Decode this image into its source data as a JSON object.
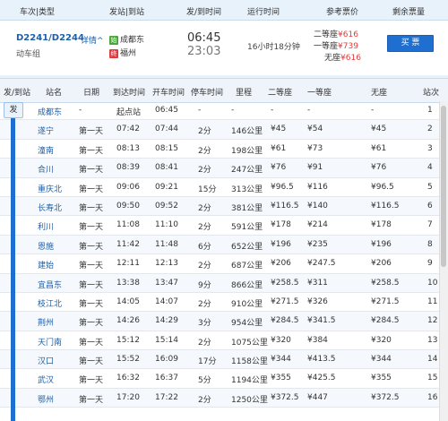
{
  "header": {
    "train_type": "车次|类型",
    "from_to": "发站|到站",
    "depart_arrive": "发/到时间",
    "duration": "运行时间",
    "ref_price": "参考票价",
    "remain": "剩余票量"
  },
  "train": {
    "number": "D2241/D2244",
    "detail_label": "详情",
    "type": "动车组",
    "from_tag": "始",
    "from_station": "成都东",
    "to_tag": "终",
    "to_station": "福州",
    "depart_time": "06:45",
    "arrive_time": "23:03",
    "duration": "16小时18分钟",
    "prices": [
      {
        "label": "二等座",
        "value": "¥616"
      },
      {
        "label": "一等座",
        "value": "¥739"
      },
      {
        "label": "无座",
        "value": "¥616"
      }
    ],
    "buy_label": "买 票"
  },
  "stations_header": {
    "col_fa": "发/到站",
    "col_name": "站名",
    "col_day": "日期",
    "col_arr": "到达时间",
    "col_dep": "开车时间",
    "col_stop": "停车时间",
    "col_dist": "里程",
    "col_second": "二等座",
    "col_first": "一等座",
    "col_none": "无座",
    "col_idx": "站次"
  },
  "fa_badge": "发",
  "stations": [
    {
      "name": "成都东",
      "day": "-",
      "arr": "起点站",
      "dep": "06:45",
      "stop": "-",
      "dist": "-",
      "second": "-",
      "first": "-",
      "none": "-",
      "idx": "1"
    },
    {
      "name": "遂宁",
      "day": "第一天",
      "arr": "07:42",
      "dep": "07:44",
      "stop": "2分",
      "dist": "146公里",
      "second": "¥45",
      "first": "¥54",
      "none": "¥45",
      "idx": "2"
    },
    {
      "name": "潼南",
      "day": "第一天",
      "arr": "08:13",
      "dep": "08:15",
      "stop": "2分",
      "dist": "198公里",
      "second": "¥61",
      "first": "¥73",
      "none": "¥61",
      "idx": "3"
    },
    {
      "name": "合川",
      "day": "第一天",
      "arr": "08:39",
      "dep": "08:41",
      "stop": "2分",
      "dist": "247公里",
      "second": "¥76",
      "first": "¥91",
      "none": "¥76",
      "idx": "4"
    },
    {
      "name": "重庆北",
      "day": "第一天",
      "arr": "09:06",
      "dep": "09:21",
      "stop": "15分",
      "dist": "313公里",
      "second": "¥96.5",
      "first": "¥116",
      "none": "¥96.5",
      "idx": "5"
    },
    {
      "name": "长寿北",
      "day": "第一天",
      "arr": "09:50",
      "dep": "09:52",
      "stop": "2分",
      "dist": "381公里",
      "second": "¥116.5",
      "first": "¥140",
      "none": "¥116.5",
      "idx": "6"
    },
    {
      "name": "利川",
      "day": "第一天",
      "arr": "11:08",
      "dep": "11:10",
      "stop": "2分",
      "dist": "591公里",
      "second": "¥178",
      "first": "¥214",
      "none": "¥178",
      "idx": "7"
    },
    {
      "name": "恩施",
      "day": "第一天",
      "arr": "11:42",
      "dep": "11:48",
      "stop": "6分",
      "dist": "652公里",
      "second": "¥196",
      "first": "¥235",
      "none": "¥196",
      "idx": "8"
    },
    {
      "name": "建始",
      "day": "第一天",
      "arr": "12:11",
      "dep": "12:13",
      "stop": "2分",
      "dist": "687公里",
      "second": "¥206",
      "first": "¥247.5",
      "none": "¥206",
      "idx": "9"
    },
    {
      "name": "宜昌东",
      "day": "第一天",
      "arr": "13:38",
      "dep": "13:47",
      "stop": "9分",
      "dist": "866公里",
      "second": "¥258.5",
      "first": "¥311",
      "none": "¥258.5",
      "idx": "10"
    },
    {
      "name": "枝江北",
      "day": "第一天",
      "arr": "14:05",
      "dep": "14:07",
      "stop": "2分",
      "dist": "910公里",
      "second": "¥271.5",
      "first": "¥326",
      "none": "¥271.5",
      "idx": "11"
    },
    {
      "name": "荆州",
      "day": "第一天",
      "arr": "14:26",
      "dep": "14:29",
      "stop": "3分",
      "dist": "954公里",
      "second": "¥284.5",
      "first": "¥341.5",
      "none": "¥284.5",
      "idx": "12"
    },
    {
      "name": "天门南",
      "day": "第一天",
      "arr": "15:12",
      "dep": "15:14",
      "stop": "2分",
      "dist": "1075公里",
      "second": "¥320",
      "first": "¥384",
      "none": "¥320",
      "idx": "13"
    },
    {
      "name": "汉口",
      "day": "第一天",
      "arr": "15:52",
      "dep": "16:09",
      "stop": "17分",
      "dist": "1158公里",
      "second": "¥344",
      "first": "¥413.5",
      "none": "¥344",
      "idx": "14"
    },
    {
      "name": "武汉",
      "day": "第一天",
      "arr": "16:32",
      "dep": "16:37",
      "stop": "5分",
      "dist": "1194公里",
      "second": "¥355",
      "first": "¥425.5",
      "none": "¥355",
      "idx": "15"
    },
    {
      "name": "鄂州",
      "day": "第一天",
      "arr": "17:20",
      "dep": "17:22",
      "stop": "2分",
      "dist": "1250公里",
      "second": "¥372.5",
      "first": "¥447",
      "none": "¥372.5",
      "idx": "16"
    }
  ]
}
